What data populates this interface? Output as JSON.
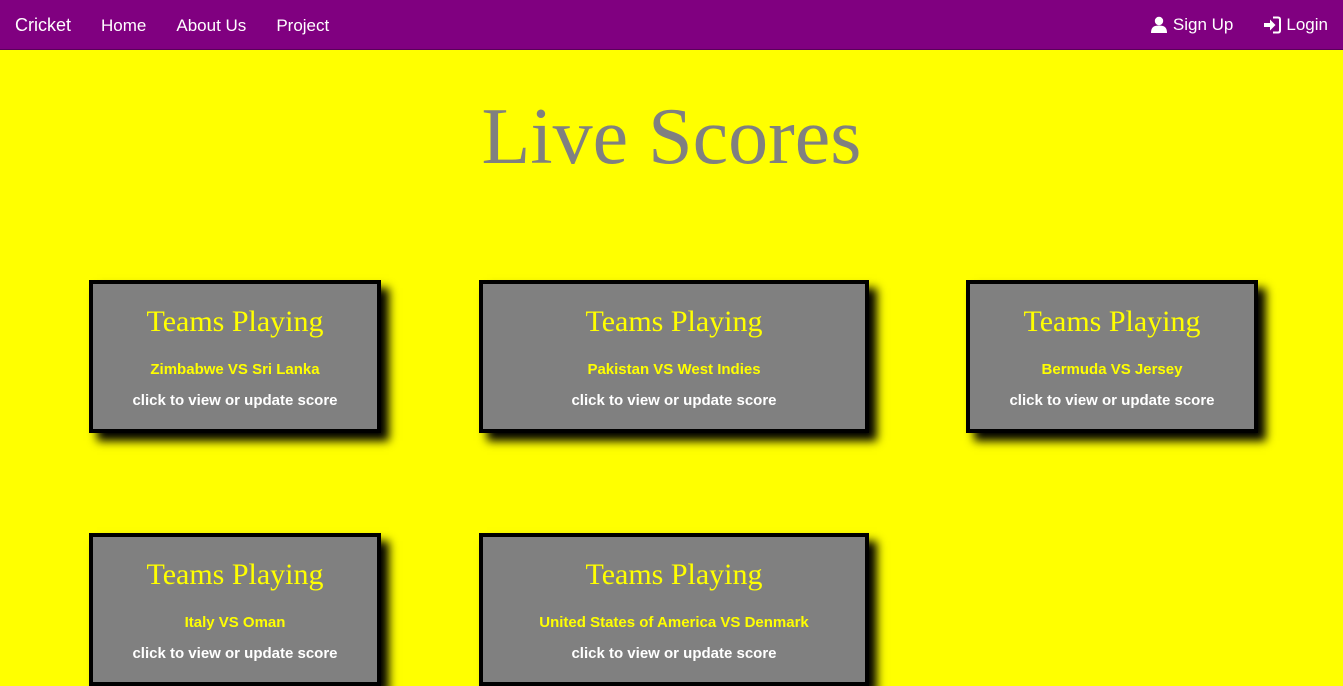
{
  "navbar": {
    "brand": "Cricket",
    "links": [
      {
        "label": "Home"
      },
      {
        "label": "About Us"
      },
      {
        "label": "Project"
      }
    ],
    "signup_label": "Sign Up",
    "signup_icon": "user-icon",
    "login_label": "Login",
    "login_icon": "login-icon",
    "background": "#800080"
  },
  "page": {
    "title": "Live Scores",
    "background": "#ffff00"
  },
  "matches": [
    {
      "heading": "Teams Playing",
      "teams": "Zimbabwe VS Sri Lanka",
      "action": "click to view or update score"
    },
    {
      "heading": "Teams Playing",
      "teams": "Pakistan VS West Indies",
      "action": "click to view or update score"
    },
    {
      "heading": "Teams Playing",
      "teams": "Bermuda VS Jersey",
      "action": "click to view or update score"
    },
    {
      "heading": "Teams Playing",
      "teams": "Italy VS Oman",
      "action": "click to view or update score"
    },
    {
      "heading": "Teams Playing",
      "teams": "United States of America VS Denmark",
      "action": "click to view or update score"
    }
  ]
}
